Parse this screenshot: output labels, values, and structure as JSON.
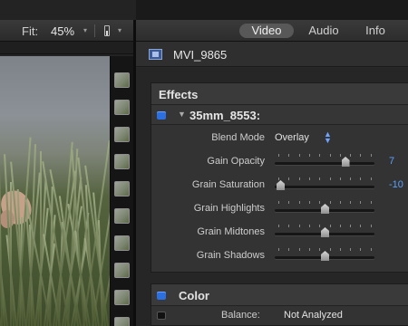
{
  "viewer": {
    "fit_label": "Fit:",
    "fit_value": "45%",
    "chevron": "▾",
    "view_icon": "viewer-options-icon"
  },
  "inspector": {
    "tabs": [
      {
        "label": "Video",
        "active": true
      },
      {
        "label": "Audio",
        "active": false
      },
      {
        "label": "Info",
        "active": false
      }
    ],
    "clip_name": "MVI_9865",
    "effects": {
      "heading": "Effects",
      "effect_name": "35mm_8553:",
      "disclosure": "▼",
      "blend_mode": {
        "label": "Blend Mode",
        "value": "Overlay",
        "stepper": "▲\n▼"
      },
      "params": [
        {
          "label": "Gain Opacity",
          "value": "7",
          "level": 0.73
        },
        {
          "label": "Grain Saturation",
          "value": "-10",
          "level": 0.0
        },
        {
          "label": "Grain Highlights",
          "value": "",
          "level": 0.5
        },
        {
          "label": "Grain Midtones",
          "value": "",
          "level": 0.5
        },
        {
          "label": "Grain Shadows",
          "value": "",
          "level": 0.5
        }
      ]
    },
    "color": {
      "heading": "Color",
      "balance_label": "Balance:",
      "balance_value": "Not Analyzed"
    }
  },
  "colors": {
    "accent_blue": "#2b6fe0",
    "value_blue": "#5aa0ff"
  }
}
